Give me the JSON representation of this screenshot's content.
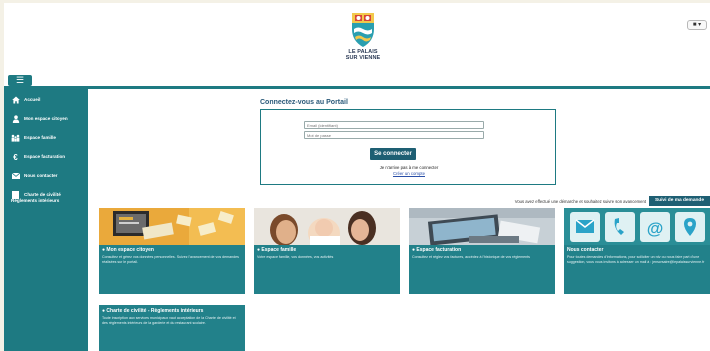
{
  "header": {
    "logo_line1": "LE PALAIS",
    "logo_line2": "SUR VIENNE",
    "user_menu": "▾"
  },
  "menu_toggle": "☰",
  "sidebar": {
    "items": [
      {
        "label": "Accueil",
        "icon": "home-icon"
      },
      {
        "label": "Mon espace citoyen",
        "icon": "user-icon"
      },
      {
        "label": "Espace famille",
        "icon": "family-icon"
      },
      {
        "label": "Espace facturation",
        "icon": "euro-icon"
      },
      {
        "label": "Nous contacter",
        "icon": "mail-icon"
      },
      {
        "label": "Charte de civilité",
        "label2": "Règlements intérieurs",
        "icon": "document-icon"
      }
    ]
  },
  "login": {
    "title": "Connectez-vous au Portail",
    "email_placeholder": "Email (identifiant)",
    "password_placeholder": "Mot de passe",
    "submit": "Se connecter",
    "no_access": "Je n'arrive pas à me connecter",
    "create_account": "Créer un compte"
  },
  "followup": {
    "text": "Vous avez effectué une démarche et souhaitez suivre son avancement",
    "button": "Suivi de ma demande"
  },
  "cards": [
    {
      "title": "Mon espace citoyen",
      "desc": "Consultez et gérez vos données personnelles. Suivez l'avancement de vos demandes réalisées sur le portail."
    },
    {
      "title": "Espace famille",
      "desc": "Votre espace famille, vos données, vos activités"
    },
    {
      "title": "Espace facturation",
      "desc": "Consultez et réglez vos factures, accédez à l'historique de vos règlements"
    },
    {
      "title": "Nous contacter",
      "desc": "Pour toutes demandes d'informations, pour solliciter un rdv ou nous faire part d'une suggestion, vous vous invitons à adresser un mail à : jenscrsaire@lepalaissurvienne.fr"
    },
    {
      "title": "Charte de civilité - Règlements intérieurs",
      "desc": "Toute inscription aux services municipaux vaut acceptation de la Charte de civilité et des règlements intérieurs de la garderie et du restaurant scolaire."
    }
  ],
  "colors": {
    "teal": "#1e7a82",
    "dark_teal": "#1e5f73",
    "card_teal": "#22818a",
    "title_blue": "#2b5a7a"
  }
}
